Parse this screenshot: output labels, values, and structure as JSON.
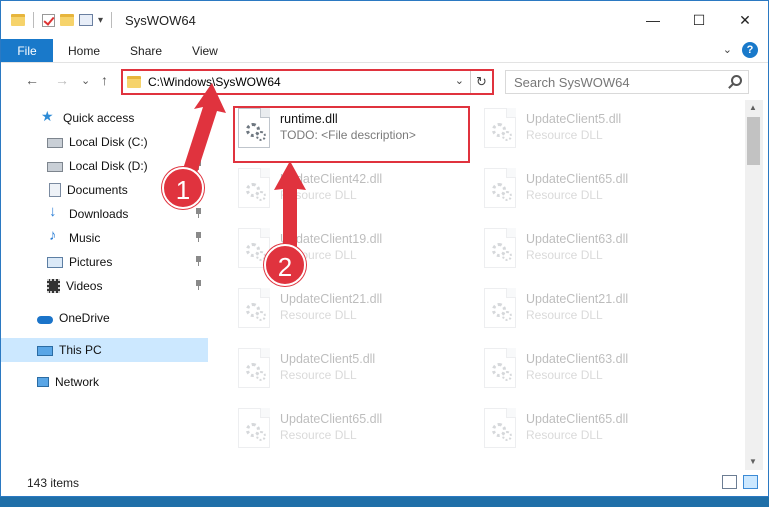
{
  "window": {
    "title": "SysWOW64",
    "min_glyph": "—",
    "max_glyph": "☐",
    "close_glyph": "✕"
  },
  "ribbon": {
    "tabs": [
      "File",
      "Home",
      "Share",
      "View"
    ],
    "expand_glyph": "⌄",
    "help_glyph": "?"
  },
  "nav": {
    "back_glyph": "←",
    "forward_glyph": "→",
    "recent_glyph": "⌄",
    "up_glyph": "↑"
  },
  "address": {
    "path": "C:\\Windows\\SysWOW64",
    "dropdown_glyph": "⌄",
    "refresh_glyph": "↻"
  },
  "search": {
    "placeholder": "Search SysWOW64"
  },
  "sidebar": {
    "items": [
      {
        "label": "Quick access",
        "icon": "star-icon",
        "pinned": false
      },
      {
        "label": "Local Disk (C:)",
        "icon": "local-disk-icon",
        "pinned": true
      },
      {
        "label": "Local Disk (D:)",
        "icon": "local-disk-icon",
        "pinned": true
      },
      {
        "label": "Documents",
        "icon": "documents-icon",
        "pinned": true
      },
      {
        "label": "Downloads",
        "icon": "downloads-icon",
        "pinned": true
      },
      {
        "label": "Music",
        "icon": "music-icon",
        "pinned": true
      },
      {
        "label": "Pictures",
        "icon": "pictures-icon",
        "pinned": true
      },
      {
        "label": "Videos",
        "icon": "videos-icon",
        "pinned": true
      },
      {
        "label": "OneDrive",
        "icon": "onedrive-icon",
        "pinned": false
      },
      {
        "label": "This PC",
        "icon": "this-pc-icon",
        "pinned": false,
        "selected": true
      },
      {
        "label": "Network",
        "icon": "network-icon",
        "pinned": false
      }
    ]
  },
  "files": [
    {
      "name": "runtime.dll",
      "desc": "TODO: <File description>",
      "highlighted": true
    },
    {
      "name": "UpdateClient5.dll",
      "desc": "Resource DLL"
    },
    {
      "name": "UpdateClient42.dll",
      "desc": "Resource DLL"
    },
    {
      "name": "UpdateClient65.dll",
      "desc": "Resource DLL"
    },
    {
      "name": "UpdateClient19.dll",
      "desc": "Resource DLL"
    },
    {
      "name": "UpdateClient63.dll",
      "desc": "Resource DLL"
    },
    {
      "name": "UpdateClient21.dll",
      "desc": "Resource DLL"
    },
    {
      "name": "UpdateClient21.dll",
      "desc": "Resource DLL"
    },
    {
      "name": "UpdateClient5.dll",
      "desc": "Resource DLL"
    },
    {
      "name": "UpdateClient63.dll",
      "desc": "Resource DLL"
    },
    {
      "name": "UpdateClient65.dll",
      "desc": "Resource DLL"
    },
    {
      "name": "UpdateClient65.dll",
      "desc": "Resource DLL"
    }
  ],
  "status": {
    "item_count": "143 items"
  },
  "callouts": {
    "step1": "1",
    "step2": "2",
    "color": "#e0333e"
  },
  "scrollbar": {
    "up_glyph": "▲",
    "down_glyph": "▼"
  }
}
